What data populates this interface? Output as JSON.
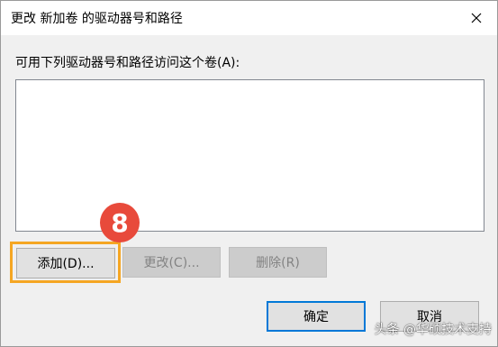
{
  "dialog": {
    "title": "更改 新加卷 的驱动器号和路径",
    "list_label": "可用下列驱动器号和路径访问这个卷(A):",
    "list_items": []
  },
  "buttons": {
    "add": "添加(D)...",
    "change": "更改(C)...",
    "delete": "删除(R)",
    "ok": "确定",
    "cancel": "取消"
  },
  "annotation": {
    "step_number": "8",
    "highlight_color": "#f5a623",
    "badge_color": "#e84a3b"
  },
  "watermark": "头条 @华硕技术支持",
  "icons": {
    "close": "close-icon"
  },
  "colors": {
    "focus_border": "#0078d7",
    "dialog_bg": "#f0f0f0",
    "disabled_text": "#838383"
  }
}
